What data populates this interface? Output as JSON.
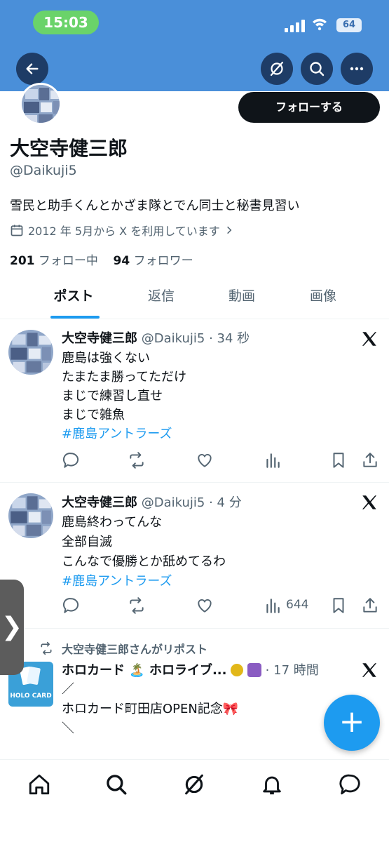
{
  "status_bar": {
    "time": "15:03",
    "battery": "64"
  },
  "profile": {
    "follow_label": "フォローする",
    "name": "大空寺健三郎",
    "handle": "@Daikuji5",
    "bio": "雪民と助手くんとかざま隊とでん同士と秘書見習い",
    "joined": "2012 年 5月から X を利用しています",
    "following_count": "201",
    "following_label": "フォロー中",
    "followers_count": "94",
    "followers_label": "フォロワー"
  },
  "tabs": [
    {
      "label": "ポスト"
    },
    {
      "label": "返信"
    },
    {
      "label": "動画"
    },
    {
      "label": "画像"
    }
  ],
  "posts": [
    {
      "name": "大空寺健三郎",
      "meta": "@Daikuji5 · 34 秒",
      "lines": [
        "鹿島は強くない",
        "たまたま勝ってただけ",
        "まじで練習し直せ",
        "まじで雑魚"
      ],
      "hashtag": "#鹿島アントラーズ",
      "views": ""
    },
    {
      "name": "大空寺健三郎",
      "meta": "@Daikuji5 · 4 分",
      "lines": [
        "鹿島終わってんな",
        "全部自滅",
        "こんなで優勝とか舐めてるわ"
      ],
      "hashtag": "#鹿島アントラーズ",
      "views": "644"
    },
    {
      "repost_label": "大空寺健三郎さんがリポスト",
      "name": "ホロカード 🏝️ ホロライブ...",
      "meta": "· 17 時間",
      "lines": [
        "／",
        "ホロカード町田店OPEN記念🎀",
        "＼"
      ],
      "avatar_text": "HOLO CARD"
    }
  ],
  "side_handle": "❯",
  "fab_label": "+",
  "colors": {
    "header": "#4a8fd9",
    "accent": "#1d9bf0",
    "text": "#0f1419",
    "muted": "#536471"
  }
}
